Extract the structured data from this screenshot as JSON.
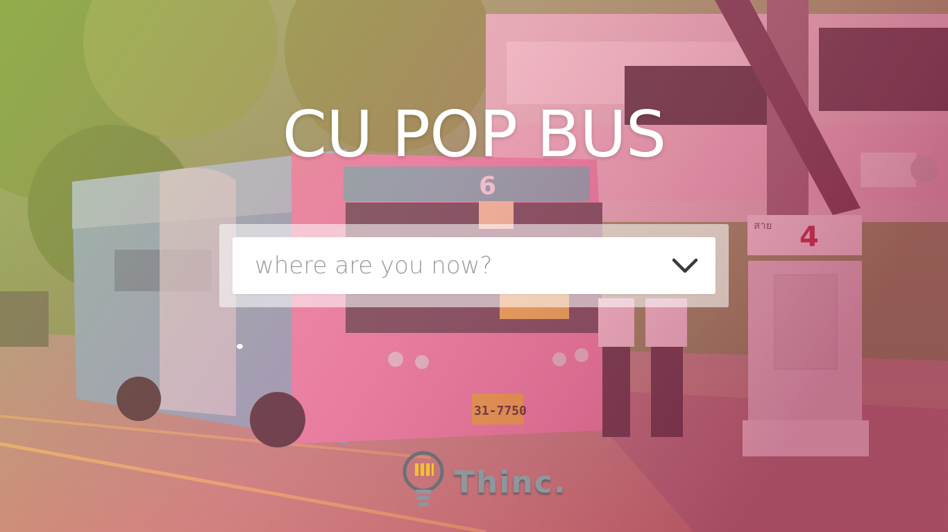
{
  "hero": {
    "title": "CU POP BUS"
  },
  "search": {
    "placeholder": "where are you now?",
    "icon": "chevron-down-icon"
  },
  "carousel": {
    "active_index": 1
  },
  "brand": {
    "name": "Thinc.",
    "icon": "lightbulb-icon"
  },
  "background": {
    "overlay_colors": [
      "#d9c25a",
      "#e6607e",
      "#9e2a4c"
    ],
    "bus_route_number": "6",
    "bus_sign_number": "4",
    "stop_sign_label": "สาย",
    "stop_sign_number": "4",
    "license_plate": "31-7750"
  }
}
